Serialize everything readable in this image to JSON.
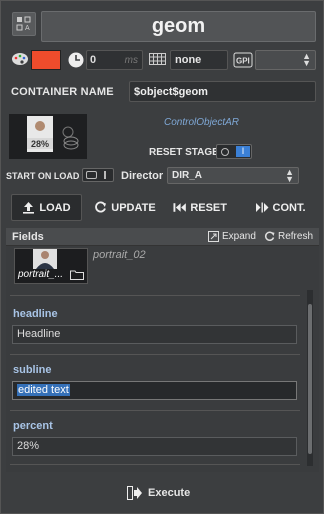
{
  "header": {
    "title": "geom",
    "type_icon": "sketch-icon"
  },
  "props": {
    "palette_icon": "palette-icon",
    "color": "#ee4c2c",
    "clock_icon": "clock-icon",
    "duration_value": "0",
    "duration_unit": "ms",
    "grid_icon": "grid-icon",
    "grid_value": "none",
    "gpi_icon": "gpi-icon",
    "gpi_value": ""
  },
  "container": {
    "label": "CONTAINER NAME",
    "value": "$object$geom"
  },
  "control": {
    "object_name": "ControlObjectAR",
    "reset_stage_label": "RESET STAGE",
    "reset_stage_on": true,
    "thumbnail_text": "28%"
  },
  "load_row": {
    "start_on_load_label": "START ON LOAD",
    "director_label": "Director",
    "director_value": "DIR_A"
  },
  "actions": {
    "load": "LOAD",
    "update": "UPDATE",
    "reset": "RESET",
    "cont": "CONT."
  },
  "fields": {
    "title": "Fields",
    "expand": "Expand",
    "refresh": "Refresh",
    "portrait": {
      "caption": "portrait_...",
      "name": "portrait_02"
    },
    "headline": {
      "label": "headline",
      "value": "Headline"
    },
    "subline": {
      "label": "subline",
      "value": "edited text"
    },
    "percent": {
      "label": "percent",
      "value": "28%"
    }
  },
  "footer": {
    "execute": "Execute"
  },
  "colors": {
    "accent": "#3b80d6",
    "swatch": "#ee4c2c",
    "field_label": "#a8c4e6"
  }
}
